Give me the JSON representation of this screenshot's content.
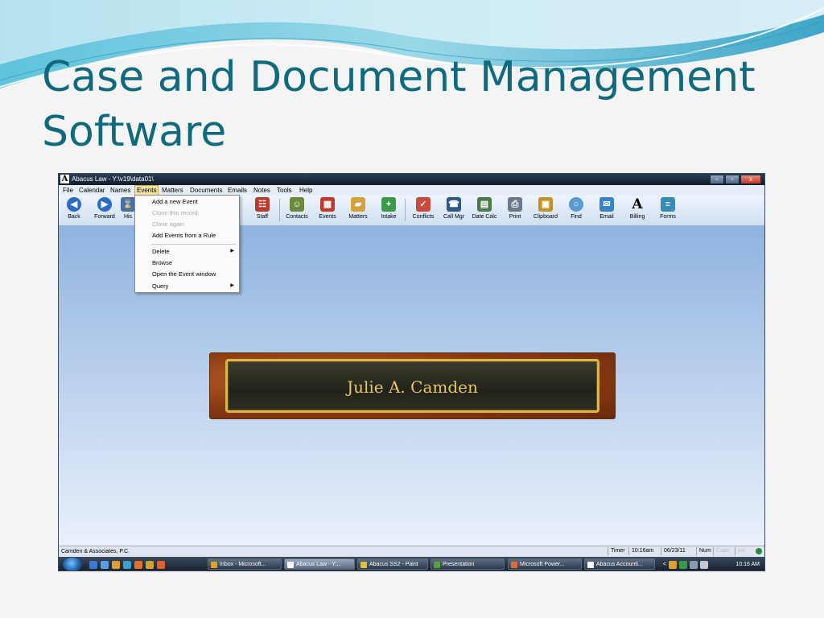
{
  "slide": {
    "title": "Case and Document Management Software"
  },
  "window": {
    "title": "Abacus Law  -  Y:\\v19\\data01\\",
    "app_icon_letter": "A",
    "controls": {
      "minimize": "–",
      "maximize": "▫",
      "close": "x"
    }
  },
  "menubar": {
    "items": [
      "File",
      "Calendar",
      "Names",
      "Events",
      "Matters",
      "Documents",
      "Emails",
      "Notes",
      "Tools",
      "Help"
    ],
    "active": "Events"
  },
  "toolbar": {
    "buttons": [
      "Back",
      "Forward",
      "His",
      "Staff",
      "Contacts",
      "Events",
      "Matters",
      "Intake",
      "Conflicts",
      "Call Mgr",
      "Date Calc",
      "Print",
      "Clipboard",
      "Find",
      "Email",
      "Billing",
      "Forms"
    ]
  },
  "events_menu": {
    "items": [
      {
        "label": "Add a new Event",
        "disabled": false
      },
      {
        "label": "Clone this record",
        "disabled": true
      },
      {
        "label": "Clone again",
        "disabled": true
      },
      {
        "label": "Add Events from a Rule",
        "disabled": false
      },
      {
        "label": "Delete",
        "disabled": false,
        "submenu": true
      },
      {
        "label": "Browse",
        "disabled": false
      },
      {
        "label": "Open the Event window",
        "disabled": false
      },
      {
        "label": "Query",
        "disabled": false,
        "submenu": true
      }
    ],
    "submenu_glyph": "▶"
  },
  "plaque": {
    "name": "Julie A. Camden"
  },
  "statusbar": {
    "firm": "Camden & Associates, P.C.",
    "timer": "Timer",
    "time": "10:16am",
    "date": "06/23/11",
    "num": "Num",
    "caps": "Caps",
    "ins": "Ins"
  },
  "taskbar": {
    "tasks": [
      "Inbox - Microsoft...",
      "Abacus Law  -  Y:...",
      "Abacus SS2 - Paint",
      "Presentation",
      "Microsoft Power...",
      "Abacus Accounti..."
    ],
    "active_task": "Abacus Law  -  Y:...",
    "tray_time": "10:16 AM",
    "tray_arrow": "<"
  },
  "colors": {
    "title_text": "#0f6a7e",
    "plaque_text": "#e6c866",
    "plaque_border": "#d8b64a",
    "content_top": "#8fb3de",
    "content_bottom": "#eaf1fb"
  },
  "icons": {
    "toolbar": [
      "back-arrow-icon",
      "forward-arrow-icon",
      "history-icon",
      "staff-icon",
      "contacts-icon",
      "events-calendar-icon",
      "matters-folder-icon",
      "intake-icon",
      "conflicts-icon",
      "call-manager-icon",
      "date-calculator-icon",
      "printer-icon",
      "clipboard-icon",
      "magnifier-icon",
      "envelope-icon",
      "billing-a-icon",
      "forms-icon"
    ]
  }
}
